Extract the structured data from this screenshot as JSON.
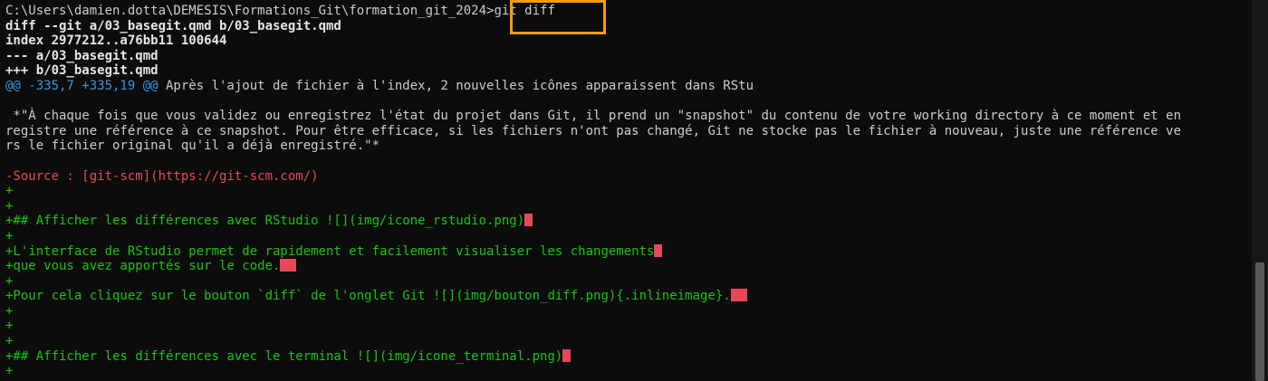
{
  "terminal": {
    "prompt": "C:\\Users\\damien.dotta\\DEMESIS\\Formations_Git\\formation_git_2024>",
    "command": "git diff",
    "header": [
      "diff --git a/03_basegit.qmd b/03_basegit.qmd",
      "index 2977212..a76bb11 100644",
      "--- a/03_basegit.qmd",
      "+++ b/03_basegit.qmd"
    ],
    "hunk_header": "@@ -335,7 +335,19 @@",
    "hunk_context": " Après l'ajout de fichier à l'index, 2 nouvelles icônes apparaissent dans RStu",
    "context_blank_1": "",
    "context_paragraph": [
      " *\"À chaque fois que vous validez ou enregistrez l'état du projet dans Git, il prend un \"snapshot\" du contenu de votre working directory à ce moment et en",
      "registre une référence à ce snapshot. Pour être efficace, si les fichiers n'ont pas changé, Git ne stocke pas le fichier à nouveau, juste une référence ve",
      "rs le fichier original qu'il a déjà enregistré.\"*"
    ],
    "context_blank_2": "",
    "removed_source": "-Source : [git-scm](https://git-scm.com/)",
    "added": {
      "plus1": "+",
      "plus2": "+",
      "heading_rstudio": "+## Afficher les différences avec RStudio ![](img/icone_rstudio.png)",
      "plus3": "+",
      "interface_line": "+L'interface de RStudio permet de rapidement et facilement visualiser les changements",
      "apportes_line": "+que vous avez apportés sur le code.",
      "plus4": "+",
      "cliquez_line": "+Pour cela cliquez sur le bouton `diff` de l'onglet Git ![](img/bouton_diff.png){.inlineimage}.",
      "plus5": "+",
      "plus6": "+",
      "plus7": "+",
      "heading_terminal": "+## Afficher les différences avec le terminal ![](img/icone_terminal.png)",
      "plus8": "+"
    }
  },
  "colors": {
    "background": "#0c0c0c",
    "text": "#cccccc",
    "hunk": "#3a96dd",
    "removed": "#e74856",
    "added": "#16c60c",
    "whitespace_error": "#e74856",
    "highlight_box": "#f39c12"
  }
}
